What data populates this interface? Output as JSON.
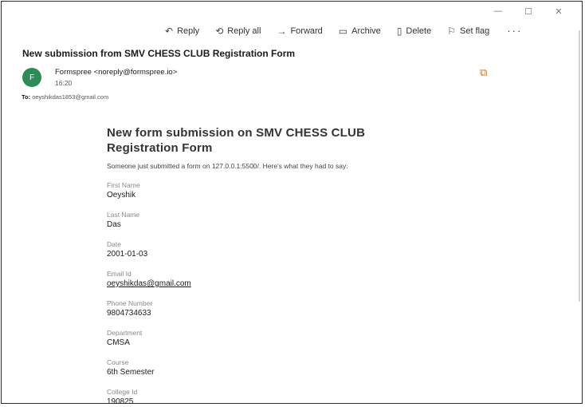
{
  "window": {
    "minimize": "—",
    "maximize": "☐",
    "close": "✕"
  },
  "toolbar": {
    "reply": "Reply",
    "reply_all": "Reply all",
    "forward": "Forward",
    "archive": "Archive",
    "delete": "Delete",
    "set_flag": "Set flag",
    "more": "···"
  },
  "message": {
    "subject": "New submission from SMV CHESS CLUB Registration Form",
    "avatar_initial": "F",
    "sender": "Formspree <noreply@formspree.io>",
    "time": "16:20",
    "to_label": "To:",
    "to_value": "oeyshikdas1853@gmail.com"
  },
  "body": {
    "title_line1": "New form submission on SMV CHESS CLUB",
    "title_line2": "Registration Form",
    "intro": "Someone just submitted a form on 127.0.0.1:5500/. Here's what they had to say:",
    "fields": [
      {
        "label": "First Name",
        "value": "Oeyshik"
      },
      {
        "label": "Last Name",
        "value": "Das"
      },
      {
        "label": "Date",
        "value": "2001-01-03"
      },
      {
        "label": "Email Id",
        "value": "oeyshikdas@gmail.com"
      },
      {
        "label": "Phone Number",
        "value": "9804734633"
      },
      {
        "label": "Department",
        "value": "CMSA"
      },
      {
        "label": "Course",
        "value": "6th Semester"
      },
      {
        "label": "College Id",
        "value": "190825"
      }
    ]
  },
  "colors": {
    "avatar": "#2e8b57",
    "popout": "#c9742b"
  }
}
